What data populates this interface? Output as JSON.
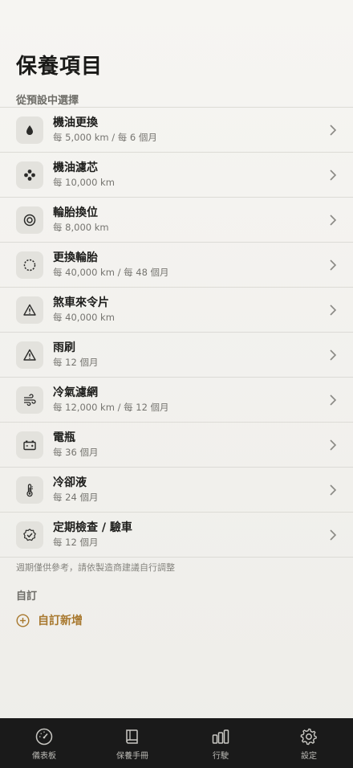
{
  "page": {
    "title": "保養項目"
  },
  "sections": {
    "preset_label": "從預設中選擇",
    "custom_label": "自訂"
  },
  "items": [
    {
      "title": "機油更換",
      "subtitle": "每 5,000 km / 每 6 個月",
      "icon": "oil-drop-icon"
    },
    {
      "title": "機油濾芯",
      "subtitle": "每 10,000 km",
      "icon": "filter-icon"
    },
    {
      "title": "輪胎換位",
      "subtitle": "每 8,000 km",
      "icon": "tire-rotate-icon"
    },
    {
      "title": "更換輪胎",
      "subtitle": "每 40,000 km / 每 48 個月",
      "icon": "tire-icon"
    },
    {
      "title": "煞車來令片",
      "subtitle": "每 40,000 km",
      "icon": "warning-icon"
    },
    {
      "title": "雨刷",
      "subtitle": "每 12 個月",
      "icon": "warning-icon"
    },
    {
      "title": "冷氣濾網",
      "subtitle": "每 12,000 km / 每 12 個月",
      "icon": "wind-icon"
    },
    {
      "title": "電瓶",
      "subtitle": "每 36 個月",
      "icon": "battery-icon"
    },
    {
      "title": "冷卻液",
      "subtitle": "每 24 個月",
      "icon": "thermometer-icon"
    },
    {
      "title": "定期檢查 / 驗車",
      "subtitle": "每 12 個月",
      "icon": "check-badge-icon"
    }
  ],
  "footnote": "週期僅供參考，請依製造商建議自行調整",
  "custom": {
    "add_label": "自訂新增"
  },
  "tabbar": [
    {
      "label": "儀表板",
      "icon": "gauge-icon"
    },
    {
      "label": "保養手冊",
      "icon": "book-icon"
    },
    {
      "label": "行駛",
      "icon": "bars-icon"
    },
    {
      "label": "設定",
      "icon": "gear-icon"
    }
  ],
  "colors": {
    "accent": "#a8782e",
    "tabbar_bg": "#1a1a1a",
    "icon_bg": "#e3e2dd"
  }
}
